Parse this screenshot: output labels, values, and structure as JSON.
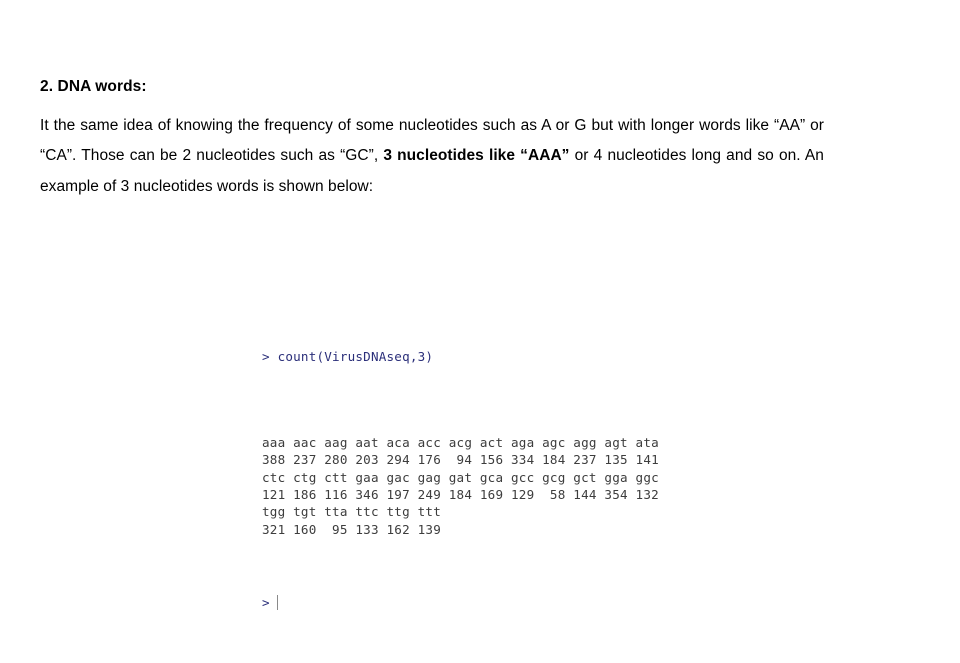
{
  "slide": {
    "heading": "2. DNA words:",
    "paragraph_segments": [
      {
        "text": "It the same idea of knowing the frequency of some nucleotides such as A or G but with longer words like “AA” or “CA”. Those can be 2 nucleotides such as “GC”, ",
        "bold": false
      },
      {
        "text": "3 nucleotides like “AAA”",
        "bold": true
      },
      {
        "text": " or 4 nucleotides long and so on. An example of 3 nucleotides words is shown below:",
        "bold": false
      }
    ]
  },
  "console": {
    "command_line": "> count(VirusDNAseq,3)",
    "prompt": ">",
    "prompt_color": "#2b2f7a",
    "text_color": "#3d3d3d",
    "blocks": [
      {
        "labels": [
          "aaa",
          "aac",
          "aag",
          "aat",
          "aca",
          "acc",
          "acg",
          "act",
          "aga",
          "agc",
          "agg",
          "agt",
          "ata"
        ],
        "values": [
          388,
          237,
          280,
          203,
          294,
          176,
          94,
          156,
          334,
          184,
          237,
          135,
          141
        ]
      },
      {
        "labels": [
          "ctc",
          "ctg",
          "ctt",
          "gaa",
          "gac",
          "gag",
          "gat",
          "gca",
          "gcc",
          "gcg",
          "gct",
          "gga",
          "ggc"
        ],
        "values": [
          121,
          186,
          116,
          346,
          197,
          249,
          184,
          169,
          129,
          58,
          144,
          354,
          132
        ]
      },
      {
        "labels": [
          "tgg",
          "tgt",
          "tta",
          "ttc",
          "ttg",
          "ttt"
        ],
        "values": [
          321,
          160,
          95,
          133,
          162,
          139
        ]
      }
    ]
  }
}
